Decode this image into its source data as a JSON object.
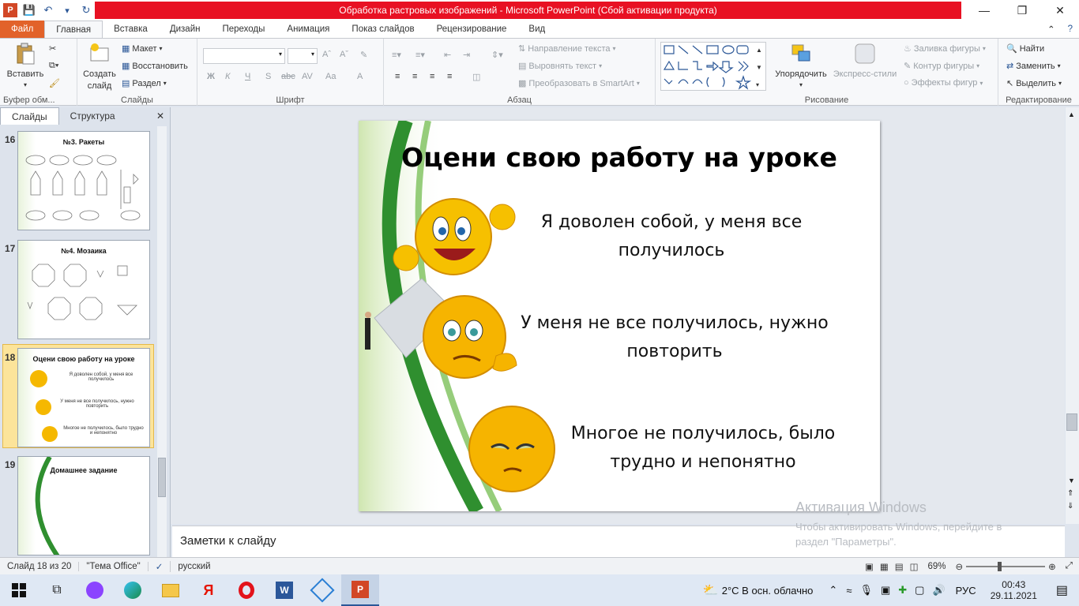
{
  "window": {
    "title": "Обработка растровых изображений  -  Microsoft PowerPoint (Сбой активации продукта)"
  },
  "tabs": {
    "file": "Файл",
    "home": "Главная",
    "insert": "Вставка",
    "design": "Дизайн",
    "transitions": "Переходы",
    "animation": "Анимация",
    "slideshow": "Показ слайдов",
    "review": "Рецензирование",
    "view": "Вид"
  },
  "ribbon": {
    "clipboard": {
      "paste": "Вставить",
      "label": "Буфер обм..."
    },
    "slides": {
      "new_slide_line1": "Создать",
      "new_slide_line2": "слайд",
      "layout": "Макет",
      "reset": "Восстановить",
      "section": "Раздел",
      "label": "Слайды"
    },
    "font": {
      "bold": "Ж",
      "italic": "К",
      "underline": "Ч",
      "shadow": "S",
      "strike": "abc",
      "spacing": "AV",
      "case": "Aa",
      "color": "A",
      "label": "Шрифт"
    },
    "paragraph": {
      "text_direction": "Направление текста",
      "align_text": "Выровнять текст",
      "smartart": "Преобразовать в SmartArt",
      "label": "Абзац"
    },
    "drawing": {
      "arrange": "Упорядочить",
      "quick_styles": "Экспресс-стили",
      "fill": "Заливка фигуры",
      "outline": "Контур фигуры",
      "effects": "Эффекты фигур",
      "label": "Рисование"
    },
    "editing": {
      "find": "Найти",
      "replace": "Заменить",
      "select": "Выделить",
      "label": "Редактирование"
    }
  },
  "leftpane": {
    "tab_slides": "Слайды",
    "tab_outline": "Структура",
    "thumbs": [
      {
        "num": "16",
        "title": "№3. Ракеты"
      },
      {
        "num": "17",
        "title": "№4. Мозаика"
      },
      {
        "num": "18",
        "title": "Оцени свою работу на уроке",
        "l1": "Я доволен собой, у меня все получилось",
        "l2": "У меня не все получилось, нужно повторить",
        "l3": "Многое не получилось, было трудно и непонятно"
      },
      {
        "num": "19",
        "title": "Домашнее задание"
      }
    ]
  },
  "slide": {
    "title": "Оцени свою работу на уроке",
    "line1a": "Я доволен собой, у меня все",
    "line1b": "получилось",
    "line2a": "У меня не все получилось, нужно",
    "line2b": "повторить",
    "line3a": "Многое не получилось, было",
    "line3b": "трудно и непонятно"
  },
  "notes": {
    "placeholder": "Заметки к слайду"
  },
  "activation": {
    "title": "Активация Windows",
    "line1": "Чтобы активировать Windows, перейдите в",
    "line2": "раздел \"Параметры\"."
  },
  "status": {
    "slide": "Слайд 18 из 20",
    "theme": "\"Тема Office\"",
    "lang": "русский",
    "zoom": "69%"
  },
  "taskbar": {
    "weather": "2°C  В осн. облачно",
    "lang": "РУС",
    "time": "00:43",
    "date": "29.11.2021"
  },
  "colors": {
    "accent": "#e2622a",
    "title_red": "#e81123",
    "green": "#2f8f2f"
  }
}
